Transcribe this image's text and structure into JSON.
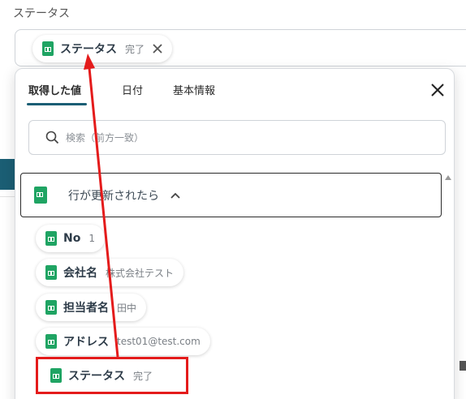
{
  "field": {
    "label": "ステータス",
    "selected_chip": {
      "label": "ステータス",
      "value": "完了"
    }
  },
  "panel": {
    "tabs": [
      "取得した値",
      "日付",
      "基本情報"
    ],
    "active_tab": "取得した値",
    "search_placeholder": "検索（前方一致）",
    "group_title": "行が更新されたら",
    "items": [
      {
        "label": "No",
        "value": "1"
      },
      {
        "label": "会社名",
        "value": "株式会社テスト"
      },
      {
        "label": "担当者名",
        "value": "田中"
      },
      {
        "label": "アドレス",
        "value": "test01@test.com"
      },
      {
        "label": "ステータス",
        "value": "完了"
      }
    ]
  },
  "icons": {
    "sheet": "google-sheets-icon",
    "close": "close-icon",
    "search": "search-icon",
    "chevron": "chevron-up-icon"
  },
  "colors": {
    "sheets_green": "#1fa463",
    "accent_teal": "#1b5e74",
    "annotation_red": "#e41b1b"
  }
}
